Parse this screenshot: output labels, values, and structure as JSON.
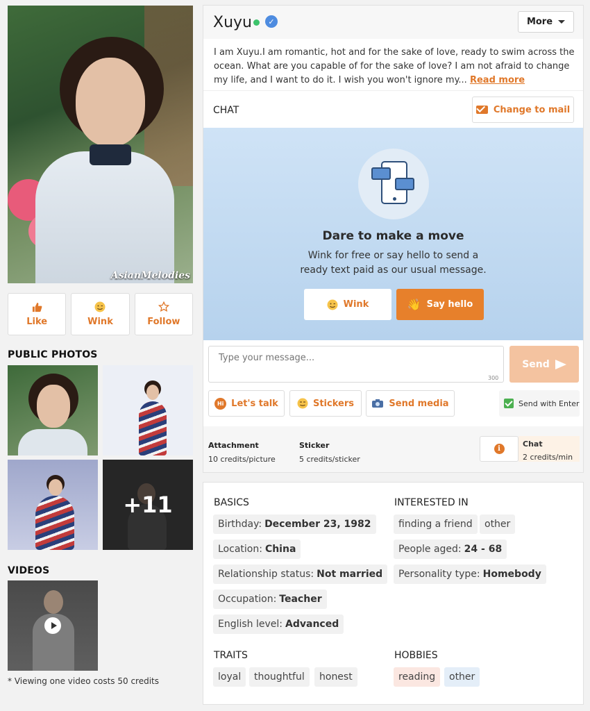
{
  "profile": {
    "name": "Xuyu",
    "bio": "I am Xuyu.I am romantic, hot and for the sake of love, ready to swim across the ocean. What are you capable of for the sake of love? I am not afraid to change my life, and I want to do it. I wish you won't ignore my...",
    "read_more": "Read more",
    "more_label": "More",
    "photo_watermark": "AsianMelodies",
    "online": true,
    "verified": true
  },
  "actions": [
    {
      "label": "Like",
      "icon": "thumbs-up-icon"
    },
    {
      "label": "Wink",
      "icon": "wink-emoji-icon"
    },
    {
      "label": "Follow",
      "icon": "star-icon"
    }
  ],
  "photos": {
    "title": "PUBLIC PHOTOS",
    "more_count": "+11"
  },
  "videos": {
    "title": "VIDEOS",
    "note": "* Viewing one video costs 50 credits"
  },
  "chat": {
    "label": "CHAT",
    "change_to_mail": "Change to mail",
    "hero_title": "Dare to make a move",
    "hero_sub_1": "Wink for free or say hello to send a",
    "hero_sub_2": "ready text paid as our usual message.",
    "wink_label": "Wink",
    "hello_label": "Say hello",
    "input_placeholder": "Type your message...",
    "char_limit": "300",
    "send_label": "Send",
    "tools": [
      "Let's talk",
      "Stickers",
      "Send media"
    ],
    "send_with_enter": "Send with Enter",
    "send_with_enter_checked": true
  },
  "pricing": {
    "attachment_title": "Attachment",
    "attachment_cost": "10 credits/picture",
    "sticker_title": "Sticker",
    "sticker_cost": "5 credits/sticker",
    "chat_title": "Chat",
    "chat_cost": "2 credits/min"
  },
  "details": {
    "basics_title": "BASICS",
    "basics": [
      {
        "label": "Birthday:",
        "value": "December 23, 1982"
      },
      {
        "label": "Location:",
        "value": "China"
      },
      {
        "label": "Relationship status:",
        "value": "Not married"
      },
      {
        "label": "Occupation:",
        "value": "Teacher"
      },
      {
        "label": "English level:",
        "value": "Advanced"
      }
    ],
    "interested_title": "INTERESTED IN",
    "interested_tags": [
      "finding a friend",
      "other"
    ],
    "interested": [
      {
        "label": "People aged:",
        "value": "24 - 68"
      },
      {
        "label": "Personality type:",
        "value": "Homebody"
      }
    ],
    "traits_title": "TRAITS",
    "traits": [
      "loyal",
      "thoughtful",
      "honest"
    ],
    "hobbies_title": "HOBBIES",
    "hobbies": [
      "reading",
      "other"
    ]
  },
  "colors": {
    "accent": "#e0782a",
    "online": "#3cc36b",
    "verified": "#4e8ce0"
  }
}
